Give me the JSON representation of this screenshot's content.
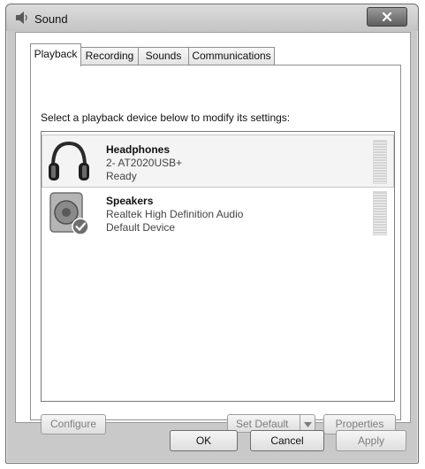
{
  "window": {
    "title": "Sound",
    "icon": "speaker-app-icon"
  },
  "tabs": [
    {
      "label": "Playback",
      "active": true
    },
    {
      "label": "Recording",
      "active": false
    },
    {
      "label": "Sounds",
      "active": false
    },
    {
      "label": "Communications",
      "active": false
    }
  ],
  "instruction": "Select a playback device below to modify its settings:",
  "devices": [
    {
      "name": "Headphones",
      "description": "2- AT2020USB+",
      "status": "Ready",
      "icon": "headphones-icon",
      "selected": true
    },
    {
      "name": "Speakers",
      "description": "Realtek High Definition Audio",
      "status": "Default Device",
      "icon": "speakers-icon",
      "selected": false
    }
  ],
  "buttons": {
    "configure": "Configure",
    "set_default": "Set Default",
    "properties": "Properties",
    "ok": "OK",
    "cancel": "Cancel",
    "apply": "Apply"
  }
}
